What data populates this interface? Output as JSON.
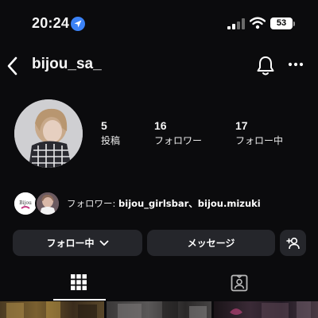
{
  "status_bar": {
    "time": "20:24",
    "battery": "53"
  },
  "header": {
    "username": "bijou_sa_"
  },
  "stats": [
    {
      "value": "5",
      "label": "投稿"
    },
    {
      "value": "16",
      "label": "フォロワー"
    },
    {
      "value": "17",
      "label": "フォロー中"
    }
  ],
  "followed_by": {
    "prefix": "フォロワー: ",
    "names": "bijou_girlsbar、bijou.mizuki",
    "mini_avatar_text": "Bijou"
  },
  "buttons": {
    "following_label": "フォロー中",
    "message_label": "メッセージ"
  },
  "colors": {
    "accent_blue": "#3b82f6",
    "button_bg": "#25262b",
    "background": "#0b0b0d"
  }
}
